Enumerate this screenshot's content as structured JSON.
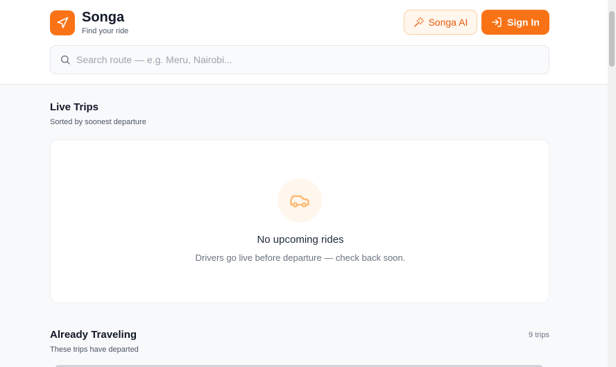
{
  "brand": {
    "name": "Songa",
    "tagline": "Find your ride",
    "accent": "#f97316",
    "icon": "navigation-arrow-icon"
  },
  "header": {
    "ai_button_label": "Songa AI",
    "ai_button_icon": "sparkles-icon",
    "signin_label": "Sign In",
    "signin_icon": "log-in-icon"
  },
  "search": {
    "placeholder": "Search route — e.g. Meru, Nairobi...",
    "value": "",
    "icon": "search-icon"
  },
  "live_trips": {
    "title": "Live Trips",
    "subtitle": "Sorted by soonest departure",
    "empty_icon": "car-icon",
    "empty_title": "No upcoming rides",
    "empty_description": "Drivers go live before departure — check back soon."
  },
  "already_traveling": {
    "title": "Already Traveling",
    "subtitle": "These trips have departed",
    "count_label": "9 trips"
  }
}
